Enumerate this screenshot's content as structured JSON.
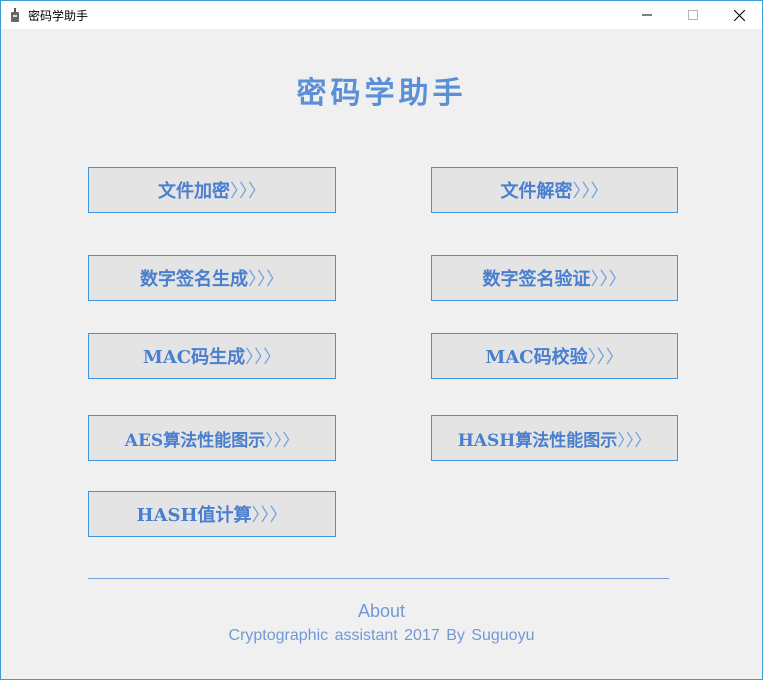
{
  "window": {
    "title": "密码学助手",
    "icon": "app-icon",
    "controls": {
      "minimize": "—",
      "maximize": "☐",
      "close": "✕"
    }
  },
  "main": {
    "heading": "密码学助手",
    "buttons": [
      {
        "label": "文件加密",
        "arrows": "〉〉〉"
      },
      {
        "label": "文件解密",
        "arrows": "〉〉〉"
      },
      {
        "label": "数字签名生成",
        "arrows": "〉〉〉"
      },
      {
        "label": "数字签名验证",
        "arrows": "〉〉〉"
      },
      {
        "label": "MAC码生成",
        "arrows": "〉〉〉"
      },
      {
        "label": "MAC码校验",
        "arrows": "〉〉〉"
      },
      {
        "label": "AES算法性能图示",
        "arrows": "〉〉〉"
      },
      {
        "label": "HASH算法性能图示",
        "arrows": "〉〉〉"
      },
      {
        "label": "HASH值计算",
        "arrows": "〉〉〉"
      }
    ]
  },
  "footer": {
    "about": "About",
    "credit": "Cryptographic assistant  2017  By Suguoyu"
  },
  "colors": {
    "accent": "#5b8fd6",
    "button_border": "#3f95e0",
    "button_bg": "#e4e4e4",
    "window_border": "#3c9bd6"
  }
}
